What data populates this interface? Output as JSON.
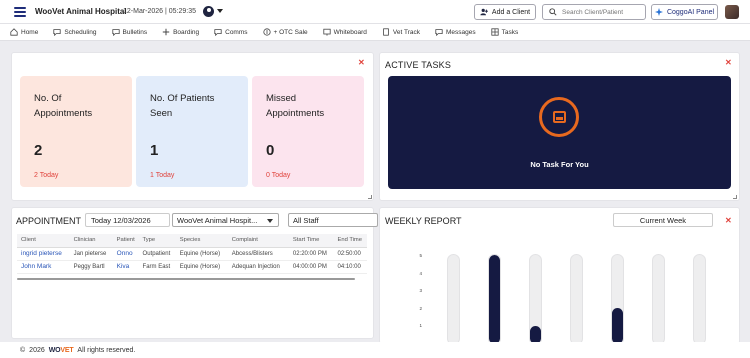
{
  "header": {
    "hospital": "WooVet Animal Hospital",
    "datetime": "12-Mar-2026 | 05:29:35",
    "add_client": "Add a Client",
    "search_placeholder": "Search Client/Patient",
    "coggo": "CoggoAI Panel"
  },
  "nav": [
    {
      "label": "Home",
      "icon": "home-icon"
    },
    {
      "label": "Scheduling",
      "icon": "chat-icon"
    },
    {
      "label": "Bulletins",
      "icon": "chat-icon"
    },
    {
      "label": "Boarding",
      "icon": "plus-icon"
    },
    {
      "label": "Comms",
      "icon": "chat-icon"
    },
    {
      "label": "+ OTC Sale",
      "icon": "dollar-icon"
    },
    {
      "label": "Whiteboard",
      "icon": "board-icon"
    },
    {
      "label": "Vet Track",
      "icon": "doc-icon"
    },
    {
      "label": "Messages",
      "icon": "chat-icon"
    },
    {
      "label": "Tasks",
      "icon": "grid-icon"
    }
  ],
  "stats": [
    {
      "title": "No. Of Appointments",
      "value": "2",
      "sub": "2 Today"
    },
    {
      "title": "No. Of Patients Seen",
      "value": "1",
      "sub": "1 Today"
    },
    {
      "title": "Missed Appointments",
      "value": "0",
      "sub": "0 Today"
    }
  ],
  "tasks": {
    "title": "ACTIVE TASKS",
    "empty": "No Task For You"
  },
  "appointment": {
    "title": "APPOINTMENT",
    "date": "Today 12/03/2026",
    "hospital": "WooVet Animal Hospit...",
    "staff": "All Staff",
    "columns": [
      "Client",
      "Clinician",
      "Patient",
      "Type",
      "Species",
      "Complaint",
      "Start Time",
      "End Time"
    ],
    "rows": [
      [
        "ingrid pieterse",
        "Jan pieterse",
        "Onno",
        "Outpatient",
        "Equine (Horse)",
        "Abcess/Blisters",
        "02:20:00 PM",
        "02:50:00"
      ],
      [
        "John Mark",
        "Peggy Bartl",
        "Kiva",
        "Farm East",
        "Equine (Horse)",
        "Adequan Injection",
        "04:00:00 PM",
        "04:10:00"
      ]
    ]
  },
  "weekly": {
    "title": "WEEKLY REPORT",
    "period": "Current Week",
    "chart_data": {
      "type": "bar",
      "ylim": [
        0,
        5
      ],
      "yticks": [
        "5",
        "4",
        "3",
        "2",
        "1",
        "0"
      ],
      "values": [
        0,
        5,
        1,
        0,
        2,
        0,
        0
      ]
    }
  },
  "footer": {
    "year": "2026",
    "brand_a": "WO",
    "brand_b": "VET",
    "rights": "All rights reserved."
  }
}
